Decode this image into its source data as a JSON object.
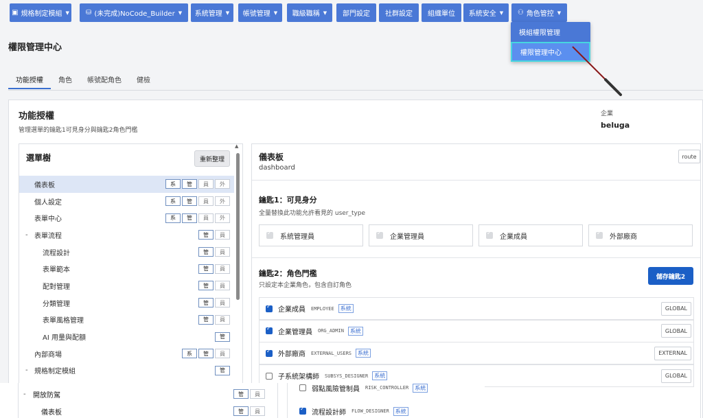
{
  "nav": {
    "items": [
      {
        "label": "規格制定模組",
        "icon": "grid-icon"
      },
      {
        "label": "(未完成)NoCode_Builder",
        "icon": "database-icon"
      },
      {
        "label": "系統管理"
      },
      {
        "label": "帳號管理"
      },
      {
        "label": "職級職稱"
      },
      {
        "label": "部門設定"
      },
      {
        "label": "社群設定"
      },
      {
        "label": "組織單位"
      },
      {
        "label": "系統安全"
      },
      {
        "label": "角色管控",
        "icon": "users-icon"
      }
    ],
    "dropdown": [
      "模組權限管理",
      "權限管理中心"
    ]
  },
  "page": {
    "title": "權限管理中心"
  },
  "tabs": [
    "功能授權",
    "角色",
    "帳號配角色",
    "健檢"
  ],
  "card": {
    "title": "功能授權",
    "subtitle": "管理選單的鑰匙1可見身分與鑰匙2角色門檻",
    "enterprise_label": "企業",
    "enterprise_value": "beluga"
  },
  "tree": {
    "title": "選單樹",
    "refresh_label": "重新整理",
    "rows": [
      {
        "label": "儀表板",
        "badges": [
          "系",
          "管",
          "員",
          "外"
        ]
      },
      {
        "label": "個人設定",
        "badges": [
          "系",
          "管",
          "員",
          "外"
        ]
      },
      {
        "label": "表單中心",
        "badges": [
          "系",
          "管",
          "員",
          "外"
        ]
      },
      {
        "label": "表單流程",
        "badges": [
          "管",
          "員"
        ]
      },
      {
        "label": "流程設計",
        "badges": [
          "管",
          "員"
        ]
      },
      {
        "label": "表單範本",
        "badges": [
          "管",
          "員"
        ]
      },
      {
        "label": "配對管理",
        "badges": [
          "管",
          "員"
        ]
      },
      {
        "label": "分類管理",
        "badges": [
          "管",
          "員"
        ]
      },
      {
        "label": "表單風格管理",
        "badges": [
          "管",
          "員"
        ]
      },
      {
        "label": "AI 用量與配額",
        "badges": [
          "管"
        ]
      },
      {
        "label": "內部商場",
        "badges": [
          "系",
          "管",
          "員"
        ]
      },
      {
        "label": "規格制定模組",
        "badges": [
          "管"
        ]
      }
    ],
    "dash": "-"
  },
  "detail": {
    "title": "儀表板",
    "route": "dashboard",
    "route_tag": "route",
    "key1_title": "鑰匙1：可見身分",
    "key1_sub": "全量替換此功能允許看見的 user_type",
    "user_types": [
      "系統管理員",
      "企業管理員",
      "企業成員",
      "外部廠商"
    ],
    "key2_title": "鑰匙2：角色門檻",
    "key2_sub": "只設定本企業角色，包含自訂角色",
    "save_label": "儲存鑰匙2",
    "roles": [
      {
        "name": "企業成員",
        "code": "EMPLOYEE",
        "tag": "系統",
        "scope": "GLOBAL",
        "checked": true
      },
      {
        "name": "企業管理員",
        "code": "ORG_ADMIN",
        "tag": "系統",
        "scope": "GLOBAL",
        "checked": true
      },
      {
        "name": "外部廠商",
        "code": "EXTERNAL_USERS",
        "tag": "系統",
        "scope": "EXTERNAL",
        "checked": true
      },
      {
        "name": "子系統架構師",
        "code": "SUBSYS_DESIGNER",
        "tag": "系統",
        "scope": "GLOBAL",
        "checked": false
      }
    ]
  },
  "ghost": {
    "tree_rows": [
      {
        "label": "開放防駕",
        "badges": [
          "管",
          "員"
        ]
      },
      {
        "label": "儀表板",
        "badges": [
          "管",
          "員"
        ]
      }
    ],
    "roles": [
      {
        "name": "弱點風險管制員",
        "code": "RISK_CONTROLLER",
        "tag": "系統",
        "checked": false
      },
      {
        "name": "流程設計師",
        "code": "FLOW_DESIGNER",
        "tag": "系統",
        "checked": true
      }
    ]
  }
}
